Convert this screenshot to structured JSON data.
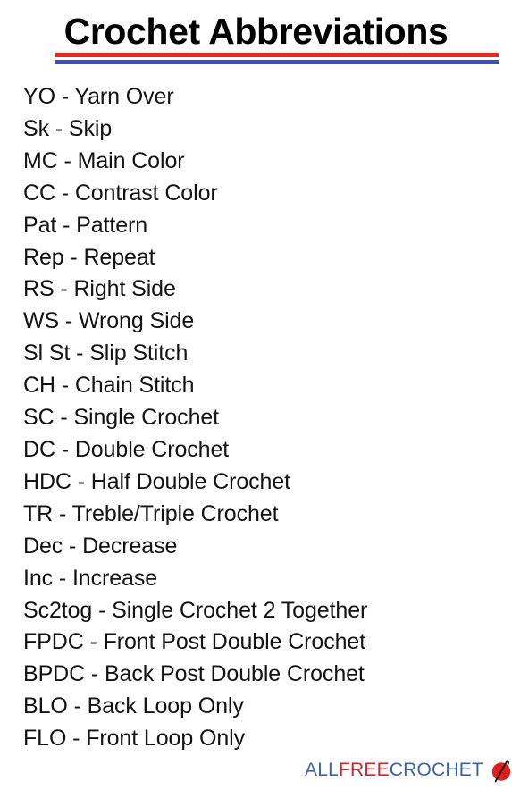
{
  "document": {
    "title": "Crochet Abbreviations",
    "background_color": "#ffffff",
    "text_color": "#131313",
    "rules": {
      "top_rule_color": "#e8271f",
      "bottom_rule_color": "#4051b5"
    }
  },
  "abbreviations": [
    {
      "abbr": "YO",
      "term": "Yarn Over",
      "line": "YO - Yarn Over"
    },
    {
      "abbr": "Sk",
      "term": "Skip",
      "line": "Sk - Skip"
    },
    {
      "abbr": "MC",
      "term": "Main Color",
      "line": "MC - Main Color"
    },
    {
      "abbr": "CC",
      "term": "Contrast Color",
      "line": "CC - Contrast Color"
    },
    {
      "abbr": "Pat",
      "term": "Pattern",
      "line": "Pat - Pattern"
    },
    {
      "abbr": "Rep",
      "term": "Repeat",
      "line": "Rep - Repeat"
    },
    {
      "abbr": "RS",
      "term": "Right Side",
      "line": "RS - Right Side"
    },
    {
      "abbr": "WS",
      "term": "Wrong Side",
      "line": "WS - Wrong Side"
    },
    {
      "abbr": "Sl St",
      "term": "Slip Stitch",
      "line": "Sl St - Slip Stitch"
    },
    {
      "abbr": "CH",
      "term": "Chain Stitch",
      "line": "CH - Chain Stitch"
    },
    {
      "abbr": "SC",
      "term": "Single Crochet",
      "line": "SC - Single Crochet"
    },
    {
      "abbr": "DC",
      "term": "Double Crochet",
      "line": "DC - Double Crochet"
    },
    {
      "abbr": "HDC",
      "term": "Half Double Crochet",
      "line": "HDC - Half Double Crochet"
    },
    {
      "abbr": "TR",
      "term": "Treble/Triple Crochet",
      "line": "TR - Treble/Triple Crochet"
    },
    {
      "abbr": "Dec",
      "term": "Decrease",
      "line": "Dec - Decrease"
    },
    {
      "abbr": "Inc",
      "term": "Increase",
      "line": "Inc - Increase"
    },
    {
      "abbr": "Sc2tog",
      "term": "Single Crochet 2 Together",
      "line": "Sc2tog - Single Crochet 2 Together"
    },
    {
      "abbr": "FPDC",
      "term": "Front Post Double Crochet",
      "line": "FPDC - Front Post Double Crochet"
    },
    {
      "abbr": "BPDC",
      "term": "Back Post Double Crochet",
      "line": "BPDC - Back Post Double Crochet"
    },
    {
      "abbr": "BLO",
      "term": "Back Loop Only",
      "line": "BLO - Back Loop Only"
    },
    {
      "abbr": "FLO",
      "term": "Front Loop Only",
      "line": "FLO - Front Loop Only"
    }
  ],
  "footer": {
    "logo": {
      "part_all": "ALL",
      "part_free": "FREE",
      "part_crochet": "CROCHET",
      "full_text": "ALLFREECROCHET",
      "color_all": "#3f62a0",
      "color_free": "#c9252c",
      "color_crochet": "#3f62a0",
      "mark": "yarn-ball-with-hook",
      "mark_color": "#e02020",
      "hook_color": "#1b1b1b"
    }
  }
}
